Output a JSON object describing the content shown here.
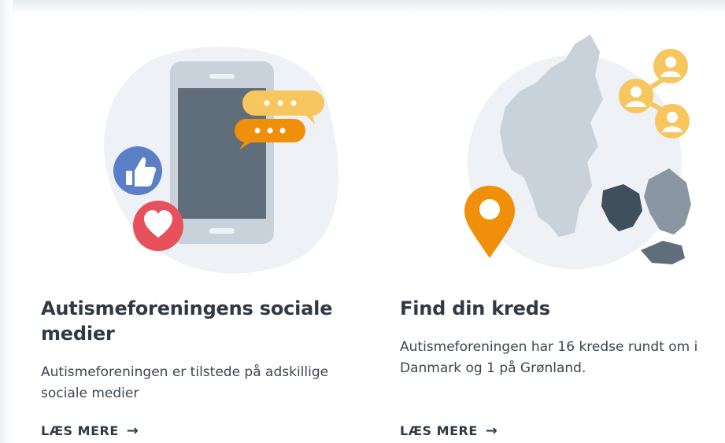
{
  "cards": [
    {
      "title": "Autismeforeningens sociale medier",
      "description": "Autismeforeningen er tilstede på adskillige sociale medier",
      "link_label": "LÆS MERE",
      "illustration_icon": "phone-social-icon"
    },
    {
      "title": "Find din kreds",
      "description": "Autismeforeningen har 16 kredse rundt om i Danmark og 1 på Grønland.",
      "link_label": "LÆS MERE",
      "illustration_icon": "denmark-map-icon"
    }
  ],
  "colors": {
    "heading": "#2f3a45",
    "accent_orange": "#f0900a",
    "accent_yellow": "#f7c65e",
    "like_blue": "#5a7fc6",
    "heart_red": "#e8505b",
    "map_gray": "#c9d1da"
  }
}
